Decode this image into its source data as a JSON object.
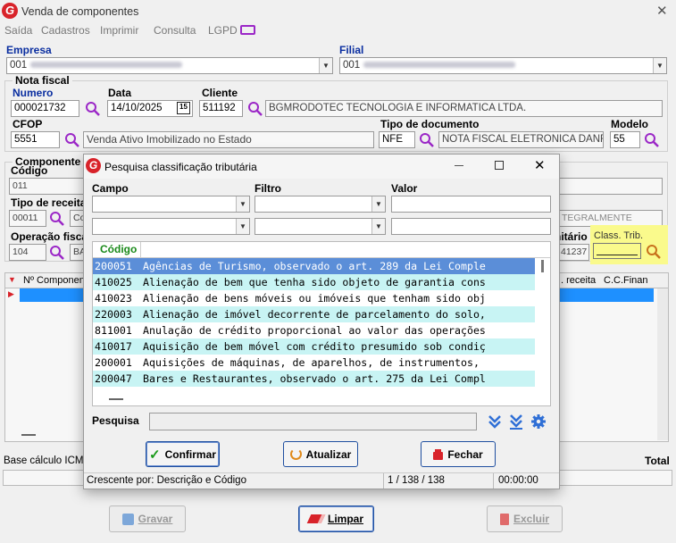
{
  "window": {
    "title": "Venda de componentes"
  },
  "menu": [
    "Saída",
    "Cadastros",
    "Imprimir",
    "Consulta",
    "LGPD"
  ],
  "empresa": {
    "label": "Empresa",
    "code": "001"
  },
  "filial": {
    "label": "Filial",
    "code": "001"
  },
  "nota": {
    "group": "Nota fiscal",
    "numero_label": "Numero",
    "numero": "000021732",
    "data_label": "Data",
    "data": "14/10/2025",
    "cliente_label": "Cliente",
    "cliente_code": "511192",
    "cliente_name": "BGMRODOTEC TECNOLOGIA E INFORMATICA LTDA.",
    "cfop_label": "CFOP",
    "cfop": "5551",
    "cfop_desc": "Venda Ativo Imobilizado no Estado",
    "tipodoc_label": "Tipo de documento",
    "tipodoc": "NFE",
    "tipodoc_desc": "NOTA FISCAL ELETRONICA DANFE",
    "modelo_label": "Modelo",
    "modelo": "55",
    "calendar_day": "15"
  },
  "componente": {
    "group": "Componente",
    "codigo_label": "Código",
    "codigo": "011",
    "tipo_label": "Tipo de receita",
    "tipo_code": "00011",
    "tipo_desc": "Co",
    "tipo_right": "TEGRALMENTE",
    "operacao_label": "Operação fisca",
    "operacao_code": "104",
    "operacao_desc": "BA",
    "unitario_label": "nitário",
    "unitario": "41237",
    "class_label": "Class. Trib."
  },
  "grid": {
    "col1": "Nº Componen",
    "col2": ". receita",
    "col3": "C.C.Finan"
  },
  "footer": {
    "base_label": "Base cálculo ICMS",
    "total_label": "Total"
  },
  "buttons": {
    "gravar": "Gravar",
    "limpar": "Limpar",
    "excluir": "Excluir"
  },
  "dialog": {
    "title": "Pesquisa classificação tributária",
    "campo_label": "Campo",
    "filtro_label": "Filtro",
    "valor_label": "Valor",
    "col_codigo": "Código",
    "rows": [
      {
        "code": "200051",
        "desc": "Agências de Turismo, observado o art. 289 da Lei Comple"
      },
      {
        "code": "410025",
        "desc": "Alienação de bem que tenha sido objeto de garantia cons"
      },
      {
        "code": "410023",
        "desc": "Alienação de bens móveis ou imóveis que tenham sido obj"
      },
      {
        "code": "220003",
        "desc": "Alienação de imóvel decorrente de parcelamento do solo,"
      },
      {
        "code": "811001",
        "desc": "Anulação de crédito proporcional ao valor das operações"
      },
      {
        "code": "410017",
        "desc": "Aquisição de bem móvel com crédito presumido sob condiç"
      },
      {
        "code": "200001",
        "desc": "Aquisições de máquinas, de aparelhos, de instrumentos,"
      },
      {
        "code": "200047",
        "desc": "Bares e Restaurantes, observado o art. 275 da Lei Compl"
      }
    ],
    "pesquisa_label": "Pesquisa",
    "confirmar": "Confirmar",
    "atualizar": "Atualizar",
    "fechar": "Fechar",
    "status_sort": "Crescente por: Descrição e Código",
    "status_count": "1 / 138 / 138",
    "status_time": "00:00:00"
  },
  "colors": {
    "accent": "#0a2ea0",
    "selected": "#5b8ed8",
    "row_alt": "#c8f4f4",
    "highlight": "#fafa8c",
    "brand": "#d8232a"
  }
}
